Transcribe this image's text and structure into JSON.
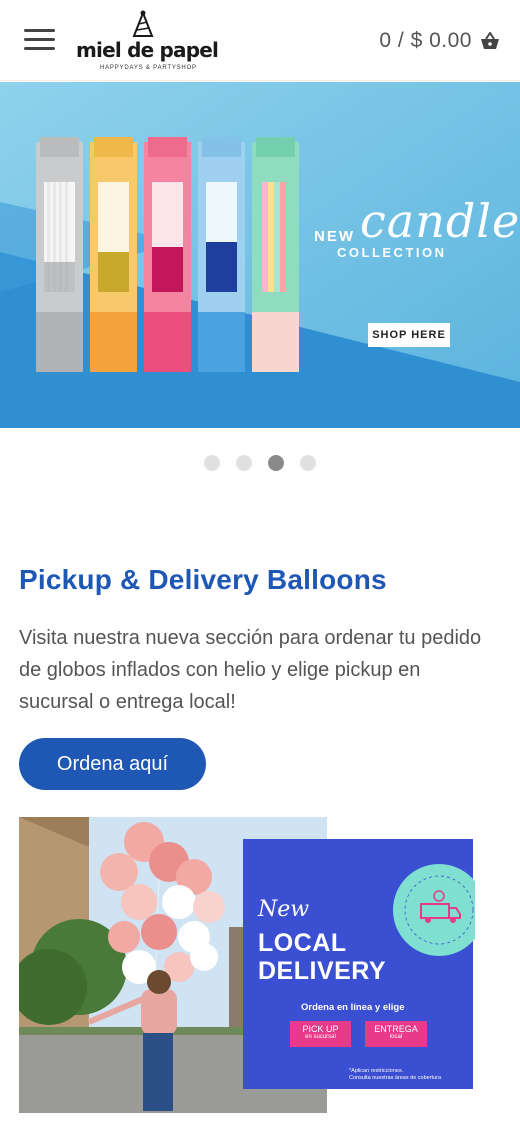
{
  "header": {
    "brand_name": "miel de papel",
    "brand_tagline": "HAPPYDAYS & PARTYSHOP",
    "cart_summary": "0 / $ 0.00",
    "menu_icon": "hamburger-icon",
    "cart_icon": "basket-icon"
  },
  "hero": {
    "new_label": "NEW",
    "candle_label": "candle",
    "collection_label": "COLLECTION",
    "shop_label": "SHOP HERE",
    "bg_color": "#2f8fd0"
  },
  "carousel": {
    "slide_count": 4,
    "active_index": 2
  },
  "section": {
    "title": "Pickup & Delivery Balloons",
    "description": "Visita nuestra nueva sección para ordenar tu pedido de globos inflados con helio y elige pickup en sucursal o entrega local!",
    "cta_label": "Ordena aquí"
  },
  "promo": {
    "new_label": "New",
    "headline_line1": "LOCAL",
    "headline_line2": "DELIVERY",
    "order_text": "Ordena en línea y elige",
    "pickup_label": "PICK UP",
    "pickup_sub": "en sucursal",
    "entrega_label": "ENTREGA",
    "entrega_sub": "local",
    "fine_print_1": "*Aplican restricciones.",
    "fine_print_2": "Consulta nuestras áreas de cobertura",
    "badge_text": "NEW · LOCAL DELIVERY · NEW · LOCAL DELIVERY ·",
    "card_color": "#3a4fd1",
    "button_color": "#e83a8a"
  },
  "colors": {
    "accent": "#1f57b5",
    "text": "#555555"
  }
}
